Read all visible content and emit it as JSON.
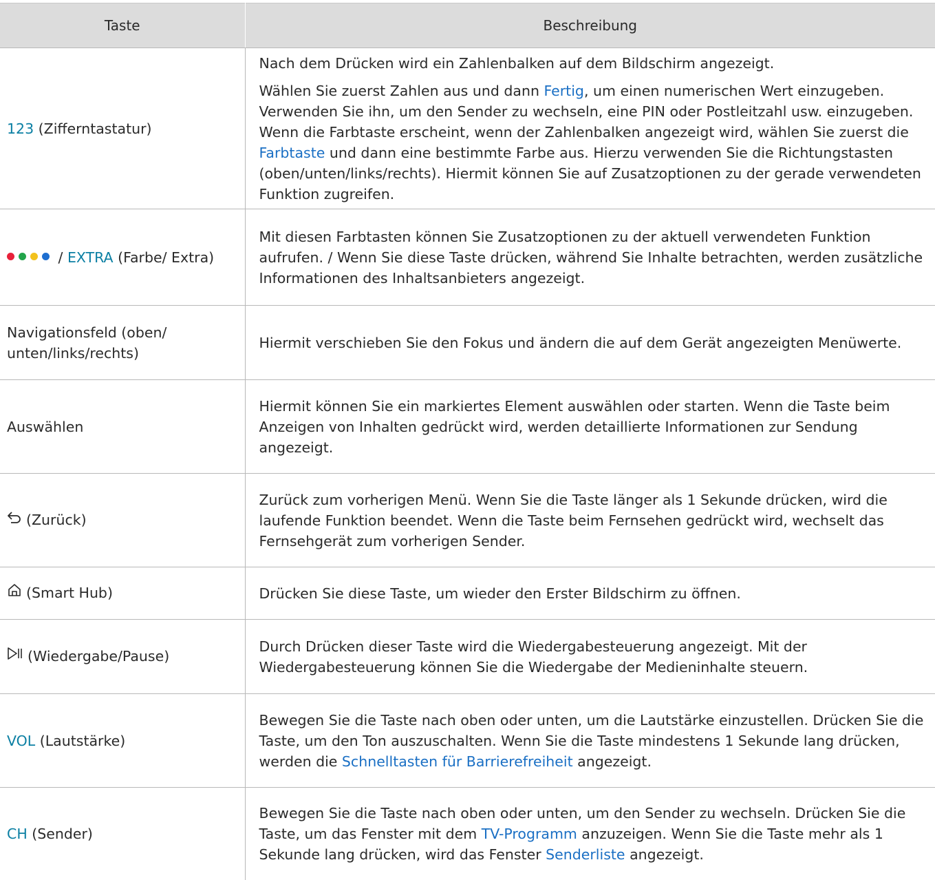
{
  "header": {
    "col_key": "Taste",
    "col_desc": "Beschreibung"
  },
  "rows": [
    {
      "key_hl": "123",
      "key_rest": " (Zifferntastatur)",
      "desc_p1": "Nach dem Drücken wird ein Zahlenbalken auf dem Bildschirm angezeigt.",
      "desc_p2_a": "Wählen Sie zuerst Zahlen aus und dann ",
      "desc_p2_link1": "Fertig",
      "desc_p2_b": ", um einen numerischen Wert einzugeben. Verwenden Sie ihn, um den Sender zu wechseln, eine PIN oder Postleitzahl usw. einzugeben. Wenn die Farbtaste erscheint, wenn der Zahlenbalken angezeigt wird, wählen Sie zuerst die ",
      "desc_p2_link2": "Farbtaste",
      "desc_p2_c": " und dann eine bestimmte Farbe aus. Hierzu verwenden Sie die Richtungstasten (oben/unten/links/rechts). Hiermit können Sie auf Zusatzoptionen zu der gerade verwendeten Funktion zugreifen."
    },
    {
      "dot_colors": [
        "#e8213a",
        "#22a44a",
        "#f3c21d",
        "#1e6fd0"
      ],
      "key_sep": " / ",
      "key_hl": "EXTRA",
      "key_rest": " (Farbe/ Extra)",
      "desc": "Mit diesen Farbtasten können Sie Zusatzoptionen zu der aktuell verwendeten Funktion aufrufen. / Wenn Sie diese Taste drücken, während Sie Inhalte betrachten, werden zusätzliche Informationen des Inhaltsanbieters angezeigt."
    },
    {
      "key": "Navigationsfeld (oben/ unten/links/rechts)",
      "desc": "Hiermit verschieben Sie den Fokus und ändern die auf dem Gerät angezeigten Menüwerte."
    },
    {
      "key": "Auswählen",
      "desc": "Hiermit können Sie ein markiertes Element auswählen oder starten. Wenn die Taste beim Anzeigen von Inhalten gedrückt wird, werden detaillierte Informationen zur Sendung angezeigt."
    },
    {
      "icon": "back-arrow-icon",
      "key": "(Zurück)",
      "desc": "Zurück zum vorherigen Menü. Wenn Sie die Taste länger als 1 Sekunde drücken, wird die laufende Funktion beendet. Wenn die Taste beim Fernsehen gedrückt wird, wechselt das Fernsehgerät zum vorherigen Sender."
    },
    {
      "icon": "home-icon",
      "key": "(Smart Hub)",
      "desc": "Drücken Sie diese Taste, um wieder den Erster Bildschirm zu öffnen."
    },
    {
      "icon": "play-pause-icon",
      "key": "(Wiedergabe/Pause)",
      "desc": "Durch Drücken dieser Taste wird die Wiedergabesteuerung angezeigt. Mit der Wiedergabesteuerung können Sie die Wiedergabe der Medieninhalte steuern."
    },
    {
      "key_hl": "VOL",
      "key_rest": " (Lautstärke)",
      "desc_a": "Bewegen Sie die Taste nach oben oder unten, um die Lautstärke einzustellen. Drücken Sie die Taste, um den Ton auszuschalten. Wenn Sie die Taste mindestens 1 Sekunde lang drücken, werden die ",
      "desc_link": "Schnelltasten für Barrierefreiheit",
      "desc_b": " angezeigt."
    },
    {
      "key_hl": "CH",
      "key_rest": " (Sender)",
      "desc_a": "Bewegen Sie die Taste nach oben oder unten, um den Sender zu wechseln. Drücken Sie die Taste, um das Fenster mit dem ",
      "desc_link1": "TV-Programm",
      "desc_b": " anzuzeigen. Wenn Sie die Taste mehr als 1 Sekunde lang drücken, wird das Fenster ",
      "desc_link2": "Senderliste",
      "desc_c": " angezeigt."
    }
  ]
}
